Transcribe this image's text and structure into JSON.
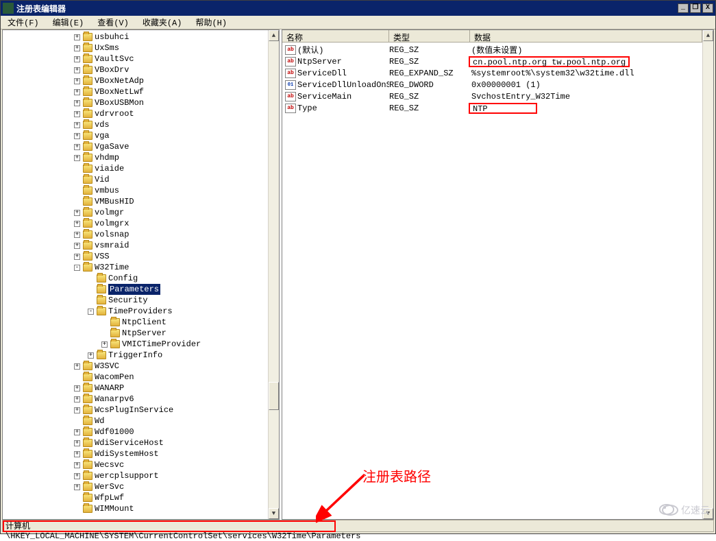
{
  "window": {
    "title": "注册表编辑器",
    "controls": {
      "min": "_",
      "max": "❐",
      "close": "X"
    }
  },
  "menu": {
    "file": "文件(F)",
    "edit": "编辑(E)",
    "view": "查看(V)",
    "fav": "收藏夹(A)",
    "help": "帮助(H)"
  },
  "tree": {
    "indent_base": 100,
    "nodes": [
      {
        "label": "usbuhci",
        "toggle": "+",
        "depth": 0
      },
      {
        "label": "UxSms",
        "toggle": "+",
        "depth": 0
      },
      {
        "label": "VaultSvc",
        "toggle": "+",
        "depth": 0
      },
      {
        "label": "VBoxDrv",
        "toggle": "+",
        "depth": 0
      },
      {
        "label": "VBoxNetAdp",
        "toggle": "+",
        "depth": 0
      },
      {
        "label": "VBoxNetLwf",
        "toggle": "+",
        "depth": 0
      },
      {
        "label": "VBoxUSBMon",
        "toggle": "+",
        "depth": 0
      },
      {
        "label": "vdrvroot",
        "toggle": "+",
        "depth": 0
      },
      {
        "label": "vds",
        "toggle": "+",
        "depth": 0
      },
      {
        "label": "vga",
        "toggle": "+",
        "depth": 0
      },
      {
        "label": "VgaSave",
        "toggle": "+",
        "depth": 0
      },
      {
        "label": "vhdmp",
        "toggle": "+",
        "depth": 0
      },
      {
        "label": "viaide",
        "toggle": "",
        "depth": 0
      },
      {
        "label": "Vid",
        "toggle": "",
        "depth": 0
      },
      {
        "label": "vmbus",
        "toggle": "",
        "depth": 0
      },
      {
        "label": "VMBusHID",
        "toggle": "",
        "depth": 0
      },
      {
        "label": "volmgr",
        "toggle": "+",
        "depth": 0
      },
      {
        "label": "volmgrx",
        "toggle": "+",
        "depth": 0
      },
      {
        "label": "volsnap",
        "toggle": "+",
        "depth": 0
      },
      {
        "label": "vsmraid",
        "toggle": "+",
        "depth": 0
      },
      {
        "label": "VSS",
        "toggle": "+",
        "depth": 0
      },
      {
        "label": "W32Time",
        "toggle": "-",
        "depth": 0
      },
      {
        "label": "Config",
        "toggle": "",
        "depth": 1
      },
      {
        "label": "Parameters",
        "toggle": "",
        "depth": 1,
        "selected": true
      },
      {
        "label": "Security",
        "toggle": "",
        "depth": 1
      },
      {
        "label": "TimeProviders",
        "toggle": "-",
        "depth": 1
      },
      {
        "label": "NtpClient",
        "toggle": "",
        "depth": 2
      },
      {
        "label": "NtpServer",
        "toggle": "",
        "depth": 2
      },
      {
        "label": "VMICTimeProvider",
        "toggle": "+",
        "depth": 2
      },
      {
        "label": "TriggerInfo",
        "toggle": "+",
        "depth": 1
      },
      {
        "label": "W3SVC",
        "toggle": "+",
        "depth": 0
      },
      {
        "label": "WacomPen",
        "toggle": "",
        "depth": 0
      },
      {
        "label": "WANARP",
        "toggle": "+",
        "depth": 0
      },
      {
        "label": "Wanarpv6",
        "toggle": "+",
        "depth": 0
      },
      {
        "label": "WcsPlugInService",
        "toggle": "+",
        "depth": 0
      },
      {
        "label": "Wd",
        "toggle": "",
        "depth": 0
      },
      {
        "label": "Wdf01000",
        "toggle": "+",
        "depth": 0
      },
      {
        "label": "WdiServiceHost",
        "toggle": "+",
        "depth": 0
      },
      {
        "label": "WdiSystemHost",
        "toggle": "+",
        "depth": 0
      },
      {
        "label": "Wecsvc",
        "toggle": "+",
        "depth": 0
      },
      {
        "label": "wercplsupport",
        "toggle": "+",
        "depth": 0
      },
      {
        "label": "WerSvc",
        "toggle": "+",
        "depth": 0
      },
      {
        "label": "WfpLwf",
        "toggle": "",
        "depth": 0
      },
      {
        "label": "WIMMount",
        "toggle": "",
        "depth": 0
      }
    ]
  },
  "list": {
    "headers": {
      "name": "名称",
      "type": "类型",
      "data": "数据"
    },
    "rows": [
      {
        "icon": "ab",
        "name": "(默认)",
        "type": "REG_SZ",
        "data": "(数值未设置)",
        "highlight": false
      },
      {
        "icon": "ab",
        "name": "NtpServer",
        "type": "REG_SZ",
        "data": "cn.pool.ntp.org tw.pool.ntp.org",
        "highlight": true
      },
      {
        "icon": "ab",
        "name": "ServiceDll",
        "type": "REG_EXPAND_SZ",
        "data": "%systemroot%\\system32\\w32time.dll",
        "highlight": false
      },
      {
        "icon": "01",
        "name": "ServiceDllUnloadOnStop",
        "type": "REG_DWORD",
        "data": "0x00000001 (1)",
        "highlight": false
      },
      {
        "icon": "ab",
        "name": "ServiceMain",
        "type": "REG_SZ",
        "data": "SvchostEntry_W32Time",
        "highlight": false
      },
      {
        "icon": "ab",
        "name": "Type",
        "type": "REG_SZ",
        "data": "NTP",
        "highlight": true
      }
    ]
  },
  "statusbar": {
    "path": "计算机\\HKEY_LOCAL_MACHINE\\SYSTEM\\CurrentControlSet\\services\\W32Time\\Parameters"
  },
  "annotation": {
    "label": "注册表路径"
  },
  "watermark": "亿速云"
}
